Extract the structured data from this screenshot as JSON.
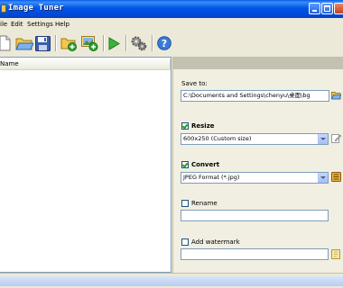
{
  "window": {
    "title": "Image Tuner",
    "accent_color": "#0055E5"
  },
  "menu": {
    "items": [
      "ile",
      "Edit",
      "Settings",
      "Help"
    ]
  },
  "toolbar": {
    "icons": [
      "new-document-icon",
      "open-folder-icon",
      "save-icon",
      "add-folder-icon",
      "add-images-icon",
      "run-icon",
      "settings-gears-icon",
      "help-icon"
    ]
  },
  "list": {
    "column_header": "Name"
  },
  "options": {
    "save_to_label": "Save to:",
    "save_to_value": "C:\\Documents and Settings\\chenyu\\桌面\\bg",
    "resize_label": "Resize",
    "resize_checked": true,
    "resize_value": "600x250 (Custom size)",
    "convert_label": "Convert",
    "convert_checked": true,
    "convert_value": "JPEG Format (*.jpg)",
    "rename_label": "Rename",
    "rename_checked": false,
    "rename_value": "",
    "watermark_label": "Add watermark",
    "watermark_checked": false,
    "watermark_value": ""
  }
}
